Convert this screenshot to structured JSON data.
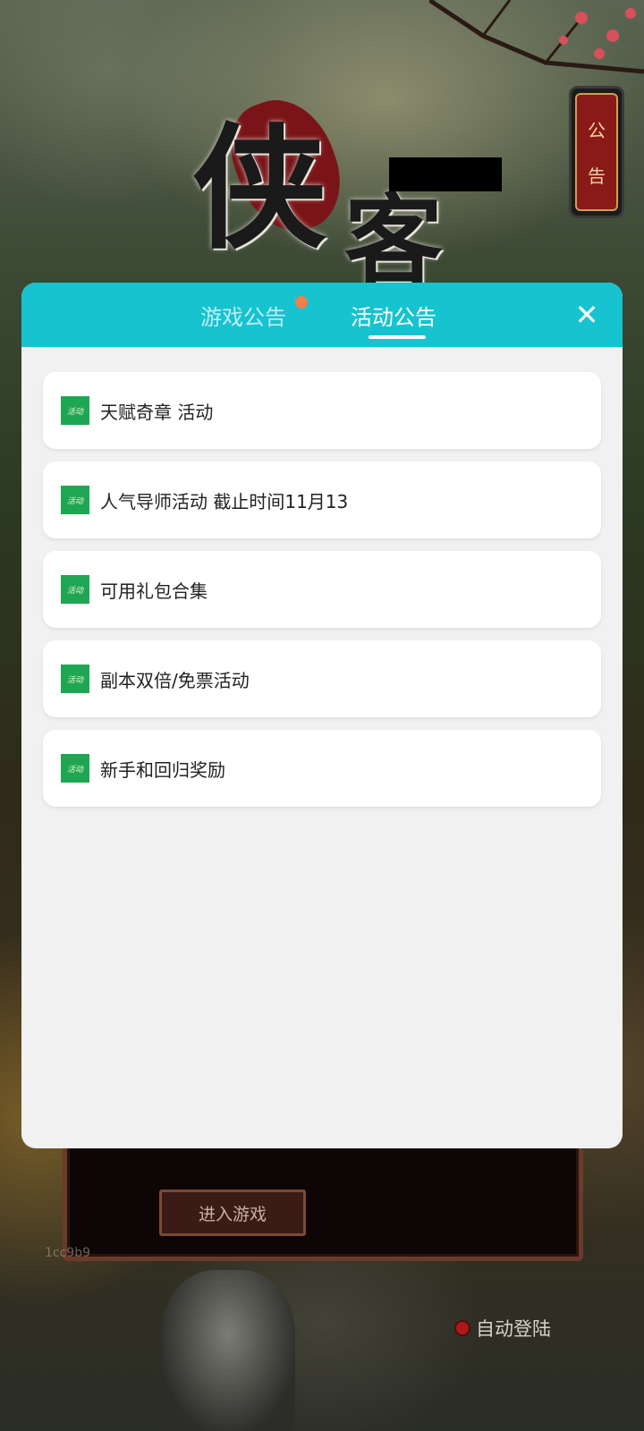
{
  "background": {
    "logo_chars": [
      "侠",
      "客"
    ],
    "notice_badge": {
      "chars": [
        "公",
        "告"
      ]
    },
    "enter_game_label": "进入游戏",
    "user_id": "1cc9b9",
    "auto_login_label": "自动登陆"
  },
  "modal": {
    "tabs": [
      {
        "label": "游戏公告",
        "active": false,
        "has_dot": true
      },
      {
        "label": "活动公告",
        "active": true,
        "has_dot": false
      }
    ],
    "close_icon": "close-icon",
    "items": [
      {
        "tag": "活动",
        "title": "天赋奇章 活动"
      },
      {
        "tag": "活动",
        "title": "人气导师活动 截止时间11月13"
      },
      {
        "tag": "活动",
        "title": "可用礼包合集"
      },
      {
        "tag": "活动",
        "title": "副本双倍/免票活动"
      },
      {
        "tag": "活动",
        "title": "新手和回归奖励"
      }
    ]
  },
  "colors": {
    "header": "#16c3cf",
    "tab_dot": "#f07f4a",
    "tag_green": "#1fa653",
    "modal_bg": "#f1f1f1"
  }
}
